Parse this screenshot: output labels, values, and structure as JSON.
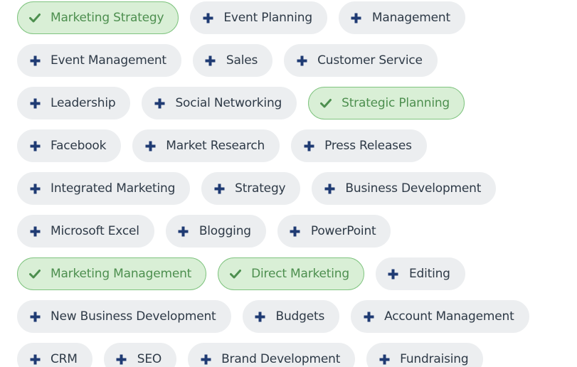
{
  "skills": {
    "rows": [
      [
        {
          "label": "Marketing Strategy",
          "selected": true
        },
        {
          "label": "Event Planning",
          "selected": false
        },
        {
          "label": "Management",
          "selected": false
        }
      ],
      [
        {
          "label": "Event Management",
          "selected": false
        },
        {
          "label": "Sales",
          "selected": false
        },
        {
          "label": "Customer Service",
          "selected": false
        }
      ],
      [
        {
          "label": "Leadership",
          "selected": false
        },
        {
          "label": "Social Networking",
          "selected": false
        },
        {
          "label": "Strategic Planning",
          "selected": true
        }
      ],
      [
        {
          "label": "Facebook",
          "selected": false
        },
        {
          "label": "Market Research",
          "selected": false
        },
        {
          "label": "Press Releases",
          "selected": false
        }
      ],
      [
        {
          "label": "Integrated Marketing",
          "selected": false
        },
        {
          "label": "Strategy",
          "selected": false
        },
        {
          "label": "Business Development",
          "selected": false
        }
      ],
      [
        {
          "label": "Microsoft Excel",
          "selected": false
        },
        {
          "label": "Blogging",
          "selected": false
        },
        {
          "label": "PowerPoint",
          "selected": false
        }
      ],
      [
        {
          "label": "Marketing Management",
          "selected": true
        },
        {
          "label": "Direct Marketing",
          "selected": true
        },
        {
          "label": "Editing",
          "selected": false
        }
      ],
      [
        {
          "label": "New Business Development",
          "selected": false
        },
        {
          "label": "Budgets",
          "selected": false
        },
        {
          "label": "Account Management",
          "selected": false
        }
      ],
      [
        {
          "label": "CRM",
          "selected": false
        },
        {
          "label": "SEO",
          "selected": false
        },
        {
          "label": "Brand Development",
          "selected": false
        },
        {
          "label": "Fundraising",
          "selected": false
        }
      ]
    ]
  },
  "icons": {
    "selected": "check-icon",
    "unselected": "plus-icon"
  },
  "colors": {
    "pill_bg": "#eceef0",
    "pill_text": "#2e3a47",
    "plus_icon": "#1f3b73",
    "selected_bg": "#d9efd6",
    "selected_border": "#7fc47f",
    "selected_text": "#4d8f4f"
  }
}
